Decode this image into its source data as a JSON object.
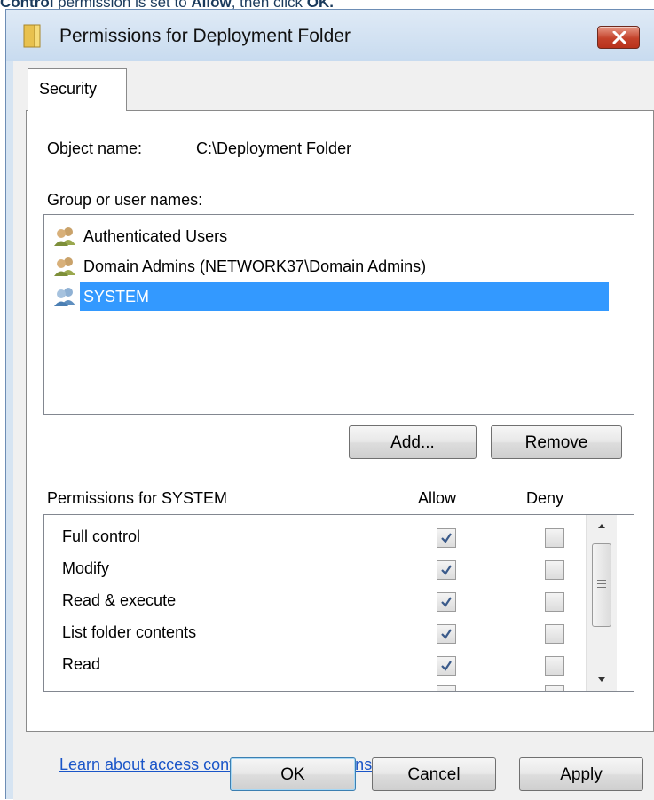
{
  "instruction": {
    "part1": "Control",
    "part2": " permission is set to ",
    "part3": "Allow",
    "part4": ", then click ",
    "part5": "OK."
  },
  "window": {
    "title": "Permissions for Deployment Folder",
    "close_icon": "close-x-icon",
    "folder_icon": "folder-icon"
  },
  "tab": {
    "label": "Security"
  },
  "object": {
    "label": "Object name:",
    "value": "C:\\Deployment Folder"
  },
  "groups": {
    "label": "Group or user names:",
    "items": [
      {
        "name": "Authenticated Users",
        "icon": "users-icon",
        "selected": false
      },
      {
        "name": "Domain Admins (NETWORK37\\Domain Admins)",
        "icon": "users-icon",
        "selected": false
      },
      {
        "name": "SYSTEM",
        "icon": "users-icon",
        "selected": true
      }
    ],
    "add_label": "Add...",
    "remove_label": "Remove"
  },
  "permissions": {
    "label": "Permissions for SYSTEM",
    "allow_header": "Allow",
    "deny_header": "Deny",
    "rows": [
      {
        "name": "Full control",
        "allow": true,
        "deny": false
      },
      {
        "name": "Modify",
        "allow": true,
        "deny": false
      },
      {
        "name": "Read & execute",
        "allow": true,
        "deny": false
      },
      {
        "name": "List folder contents",
        "allow": true,
        "deny": false
      },
      {
        "name": "Read",
        "allow": true,
        "deny": false
      }
    ]
  },
  "link": {
    "label": "Learn about access control and permissions"
  },
  "buttons": {
    "ok": "OK",
    "cancel": "Cancel",
    "apply": "Apply"
  },
  "colors": {
    "selection": "#3399ff",
    "link": "#1a55c8",
    "title_bar": "#d6e4f2"
  }
}
